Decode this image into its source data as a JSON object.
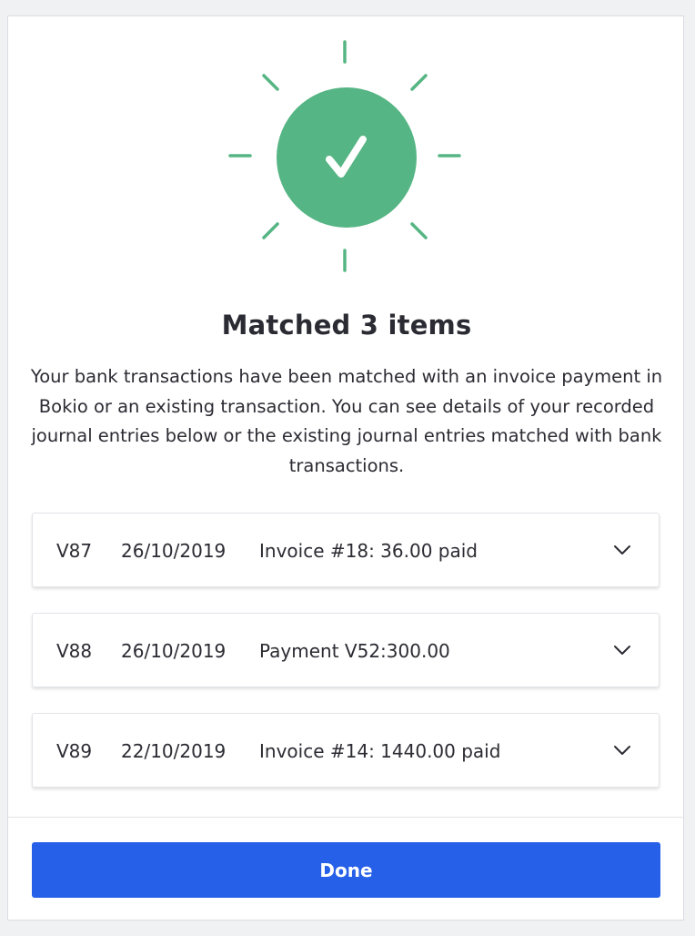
{
  "modal": {
    "success_icon": "checkmark-circle-icon",
    "accent_color": "#56b584",
    "title": "Matched 3 items",
    "description": "Your bank transactions have been matched with an invoice payment in Bokio or an existing transaction. You can see details of your recorded journal entries below or the existing journal entries matched with bank transactions.",
    "entries": [
      {
        "number": "V87",
        "date": "26/10/2019",
        "description": "Invoice #18: 36.00 paid",
        "icon": "chevron-down-icon"
      },
      {
        "number": "V88",
        "date": "26/10/2019",
        "description": "Payment V52:300.00",
        "icon": "chevron-down-icon"
      },
      {
        "number": "V89",
        "date": "22/10/2019",
        "description": "Invoice #14: 1440.00 paid",
        "icon": "chevron-down-icon"
      }
    ],
    "done_label": "Done",
    "button_color": "#2660e8"
  }
}
